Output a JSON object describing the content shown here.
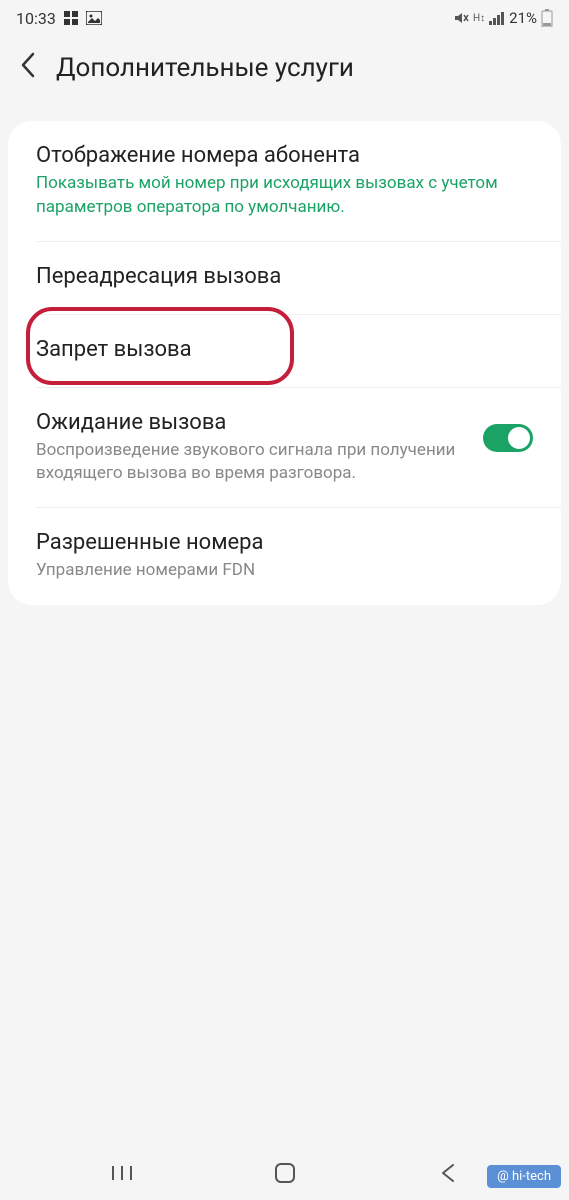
{
  "status_bar": {
    "time": "10:33",
    "battery_percent": "21%"
  },
  "header": {
    "title": "Дополнительные услуги"
  },
  "settings": {
    "caller_id": {
      "title": "Отображение номера абонента",
      "desc": "Показывать мой номер при исходящих вызовах с учетом параметров оператора по умолчанию."
    },
    "call_forwarding": {
      "title": "Переадресация вызова"
    },
    "call_barring": {
      "title": "Запрет вызова"
    },
    "call_waiting": {
      "title": "Ожидание вызова",
      "desc": "Воспроизведение звукового сигнала при получении входящего вызова во время разговора."
    },
    "fixed_dialing": {
      "title": "Разрешенные номера",
      "desc": "Управление номерами FDN"
    }
  },
  "watermark": "@ hi-tech"
}
